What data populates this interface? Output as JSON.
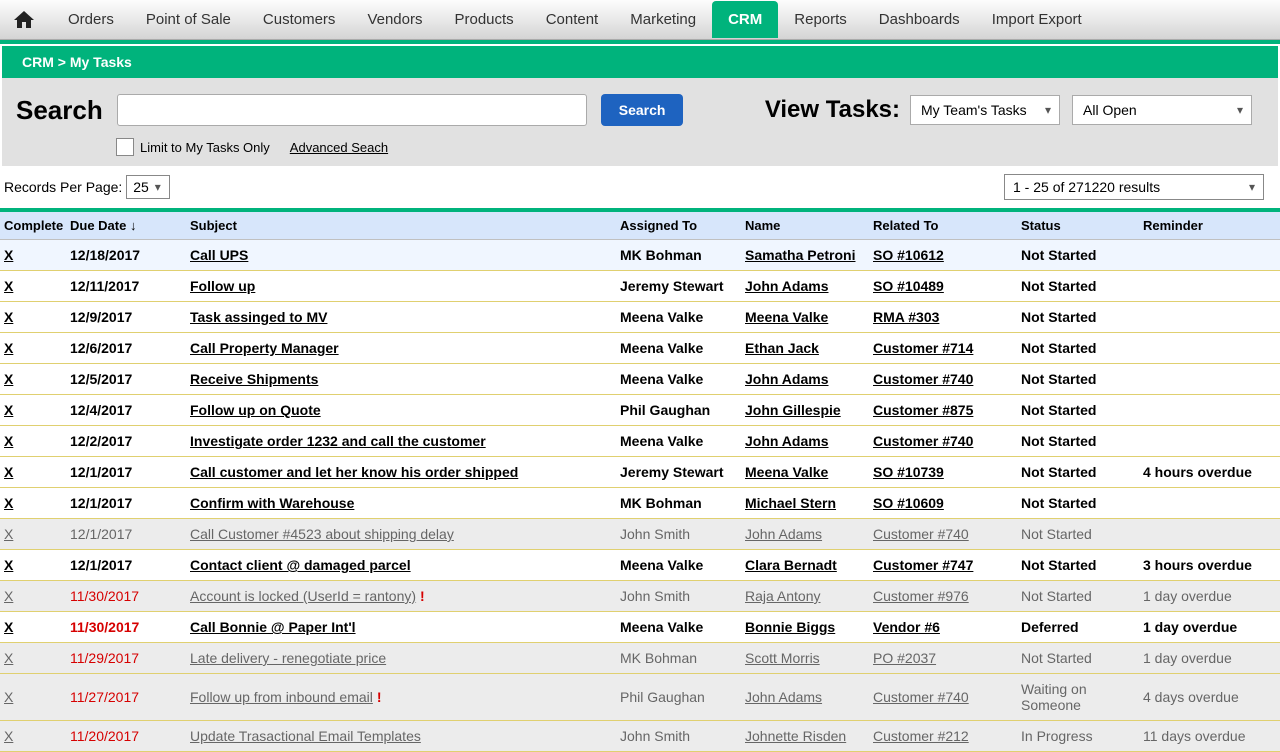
{
  "nav": {
    "items": [
      "Orders",
      "Point of Sale",
      "Customers",
      "Vendors",
      "Products",
      "Content",
      "Marketing",
      "CRM",
      "Reports",
      "Dashboards",
      "Import Export"
    ],
    "active": "CRM"
  },
  "breadcrumb": "CRM > My Tasks",
  "search": {
    "label": "Search",
    "button": "Search",
    "limit_label": "Limit to My Tasks Only",
    "advanced": "Advanced Seach",
    "view_label": "View Tasks:",
    "scope_selected": "My Team's Tasks",
    "filter_selected": "All Open"
  },
  "records": {
    "per_page_label": "Records Per Page:",
    "per_page_value": "25",
    "results_text": "1 - 25 of 271220 results"
  },
  "columns": {
    "complete": "Complete",
    "due": "Due Date",
    "subject": "Subject",
    "assigned": "Assigned To",
    "name": "Name",
    "related": "Related To",
    "status": "Status",
    "reminder": "Reminder"
  },
  "rows": [
    {
      "x": "X",
      "due": "12/18/2017",
      "subject": "Call UPS",
      "assigned": "MK Bohman",
      "name": "Samatha Petroni",
      "related": "SO #10612",
      "status": "Not Started",
      "reminder": "",
      "highlight": true
    },
    {
      "x": "X",
      "due": "12/11/2017",
      "subject": "Follow up",
      "assigned": "Jeremy Stewart",
      "name": "John Adams",
      "related": "SO #10489",
      "status": "Not Started",
      "reminder": ""
    },
    {
      "x": "X",
      "due": "12/9/2017",
      "subject": "Task assinged to MV",
      "assigned": "Meena Valke",
      "name": "Meena Valke",
      "related": "RMA #303",
      "status": "Not Started",
      "reminder": ""
    },
    {
      "x": "X",
      "due": "12/6/2017",
      "subject": "Call Property Manager",
      "assigned": "Meena Valke",
      "name": "Ethan Jack",
      "related": "Customer #714",
      "status": "Not Started",
      "reminder": ""
    },
    {
      "x": "X",
      "due": "12/5/2017",
      "subject": "Receive Shipments",
      "assigned": "Meena Valke",
      "name": "John Adams",
      "related": "Customer #740",
      "status": "Not Started",
      "reminder": ""
    },
    {
      "x": "X",
      "due": "12/4/2017",
      "subject": "Follow up on Quote",
      "assigned": "Phil Gaughan",
      "name": "John Gillespie",
      "related": "Customer #875",
      "status": "Not Started",
      "reminder": ""
    },
    {
      "x": "X",
      "due": "12/2/2017",
      "subject": "Investigate order 1232 and call the customer",
      "assigned": "Meena Valke",
      "name": "John Adams",
      "related": "Customer #740",
      "status": "Not Started",
      "reminder": ""
    },
    {
      "x": "X",
      "due": "12/1/2017",
      "subject": "Call customer and let her know his order shipped",
      "assigned": "Jeremy Stewart",
      "name": "Meena Valke",
      "related": "SO #10739",
      "status": "Not Started",
      "reminder": "4 hours overdue"
    },
    {
      "x": "X",
      "due": "12/1/2017",
      "subject": "Confirm with Warehouse",
      "assigned": "MK Bohman",
      "name": "Michael Stern",
      "related": "SO #10609",
      "status": "Not Started",
      "reminder": ""
    },
    {
      "x": "X",
      "due": "12/1/2017",
      "subject": "Call Customer #4523 about shipping delay",
      "assigned": "John Smith",
      "name": "John Adams",
      "related": "Customer #740",
      "status": "Not Started",
      "reminder": "",
      "dim": true
    },
    {
      "x": "X",
      "due": "12/1/2017",
      "subject": "Contact client @ damaged parcel",
      "assigned": "Meena Valke",
      "name": "Clara Bernadt",
      "related": "Customer #747",
      "status": "Not Started",
      "reminder": "3 hours overdue"
    },
    {
      "x": "X",
      "due": "11/30/2017",
      "subject": "Account is locked (UserId = rantony)",
      "assigned": "John Smith",
      "name": "Raja Antony",
      "related": "Customer #976",
      "status": "Not Started",
      "reminder": "1 day overdue",
      "dim": true,
      "red": true,
      "alert": true
    },
    {
      "x": "X",
      "due": "11/30/2017",
      "subject": "Call Bonnie @ Paper Int'l",
      "assigned": "Meena Valke",
      "name": "Bonnie Biggs",
      "related": "Vendor #6",
      "status": "Deferred",
      "reminder": "1 day overdue",
      "red": true
    },
    {
      "x": "X",
      "due": "11/29/2017",
      "subject": "Late delivery - renegotiate price",
      "assigned": "MK Bohman",
      "name": "Scott Morris",
      "related": "PO #2037",
      "status": "Not Started",
      "reminder": "1 day overdue",
      "dim": true,
      "red": true
    },
    {
      "x": "X",
      "due": "11/27/2017",
      "subject": "Follow up from inbound email",
      "assigned": "Phil Gaughan",
      "name": "John Adams",
      "related": "Customer #740",
      "status": "Waiting on Someone",
      "reminder": "4 days overdue",
      "dim": true,
      "red": true,
      "alert": true
    },
    {
      "x": "X",
      "due": "11/20/2017",
      "subject": "Update Trasactional Email Templates",
      "assigned": "John Smith",
      "name": "Johnette Risden",
      "related": "Customer #212",
      "status": "In Progress",
      "reminder": "11 days overdue",
      "dim": true,
      "red": true
    }
  ]
}
